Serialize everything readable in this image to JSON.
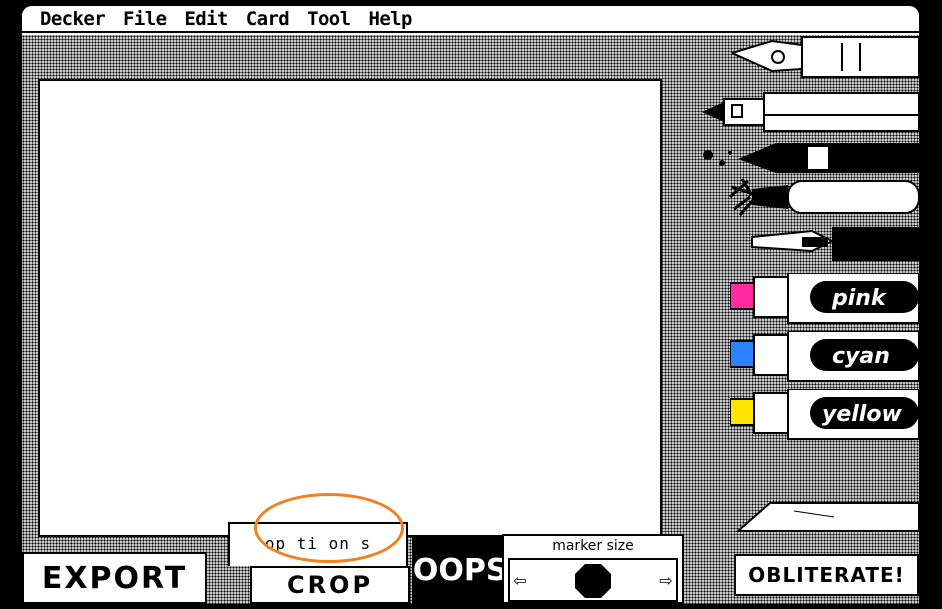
{
  "menu": {
    "items": [
      "Decker",
      "File",
      "Edit",
      "Card",
      "Tool",
      "Help"
    ]
  },
  "tools": {
    "pen_icon": "fountain-pen-icon",
    "fineliner_icon": "fineliner-pen-icon",
    "ink_icon": "ink-brush-icon",
    "brush_icon": "paint-brush-icon",
    "airbrush_icon": "airbrush-icon",
    "markers": [
      {
        "label": "pink",
        "color": "#ff2aa0"
      },
      {
        "label": "cyan",
        "color": "#2a82ff"
      },
      {
        "label": "yellow",
        "color": "#ffe600"
      }
    ],
    "eraser_icon": "eraser-icon"
  },
  "bottom": {
    "export_label": "EXPORT",
    "options_label": "op ti on s",
    "crop_label": "CROP",
    "oops_label": "OOPS!",
    "marker_size_title": "marker size",
    "left_arrow": "⇦",
    "right_arrow": "⇨",
    "obliterate_label": "OBLITERATE!"
  },
  "colors": {
    "highlight": "#f08020",
    "pink": "#ff2aa0",
    "cyan": "#2a82ff",
    "yellow": "#ffe600"
  }
}
